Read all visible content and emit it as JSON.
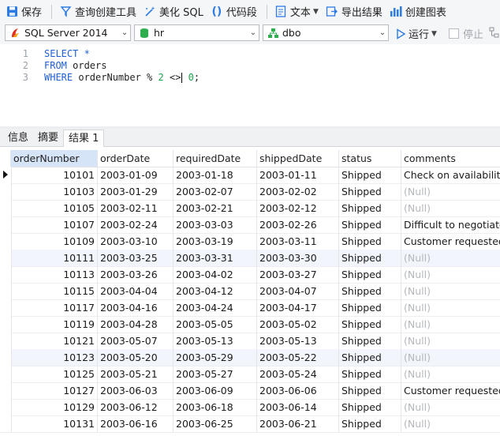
{
  "toolbar": {
    "save": "保存",
    "query_builder": "查询创建工具",
    "beautify": "美化 SQL",
    "snippet": "代码段",
    "text": "文本",
    "export": "导出结果",
    "chart": "创建图表"
  },
  "selectors": {
    "server": "SQL Server 2014",
    "database": "hr",
    "schema": "dbo",
    "run": "运行",
    "stop": "停止"
  },
  "editor": {
    "lines": [
      {
        "n": "1",
        "parts": [
          {
            "t": "SELECT *",
            "c": "kw"
          }
        ]
      },
      {
        "n": "2",
        "parts": [
          {
            "t": "FROM ",
            "c": "kw"
          },
          {
            "t": "orders",
            "c": "plain"
          }
        ]
      },
      {
        "n": "3",
        "parts": [
          {
            "t": "WHERE ",
            "c": "kw"
          },
          {
            "t": "orderNumber % ",
            "c": "plain"
          },
          {
            "t": "2",
            "c": "num"
          },
          {
            "t": " <>",
            "c": "plain"
          },
          {
            "t": " ",
            "c": "plain"
          },
          {
            "t": "0",
            "c": "num"
          },
          {
            "t": ";",
            "c": "plain"
          }
        ]
      }
    ]
  },
  "tabs": [
    "信息",
    "摘要",
    "结果 1"
  ],
  "grid": {
    "columns": [
      "orderNumber",
      "orderDate",
      "requiredDate",
      "shippedDate",
      "status",
      "comments"
    ],
    "null_text": "(Null)",
    "rows": [
      [
        "10101",
        "2003-01-09",
        "2003-01-18",
        "2003-01-11",
        "Shipped",
        "Check on availability."
      ],
      [
        "10103",
        "2003-01-29",
        "2003-02-07",
        "2003-02-02",
        "Shipped",
        null
      ],
      [
        "10105",
        "2003-02-11",
        "2003-02-21",
        "2003-02-12",
        "Shipped",
        null
      ],
      [
        "10107",
        "2003-02-24",
        "2003-03-03",
        "2003-02-26",
        "Shipped",
        "Difficult to negotiate"
      ],
      [
        "10109",
        "2003-03-10",
        "2003-03-19",
        "2003-03-11",
        "Shipped",
        "Customer requested t"
      ],
      [
        "10111",
        "2003-03-25",
        "2003-03-31",
        "2003-03-30",
        "Shipped",
        null
      ],
      [
        "10113",
        "2003-03-26",
        "2003-04-02",
        "2003-03-27",
        "Shipped",
        null
      ],
      [
        "10115",
        "2003-04-04",
        "2003-04-12",
        "2003-04-07",
        "Shipped",
        null
      ],
      [
        "10117",
        "2003-04-16",
        "2003-04-24",
        "2003-04-17",
        "Shipped",
        null
      ],
      [
        "10119",
        "2003-04-28",
        "2003-05-05",
        "2003-05-02",
        "Shipped",
        null
      ],
      [
        "10121",
        "2003-05-07",
        "2003-05-13",
        "2003-05-13",
        "Shipped",
        null
      ],
      [
        "10123",
        "2003-05-20",
        "2003-05-29",
        "2003-05-22",
        "Shipped",
        null
      ],
      [
        "10125",
        "2003-05-21",
        "2003-05-27",
        "2003-05-24",
        "Shipped",
        null
      ],
      [
        "10127",
        "2003-06-03",
        "2003-06-09",
        "2003-06-06",
        "Shipped",
        "Customer requested s"
      ],
      [
        "10129",
        "2003-06-12",
        "2003-06-18",
        "2003-06-14",
        "Shipped",
        null
      ],
      [
        "10131",
        "2003-06-16",
        "2003-06-25",
        "2003-06-21",
        "Shipped",
        null
      ]
    ]
  }
}
